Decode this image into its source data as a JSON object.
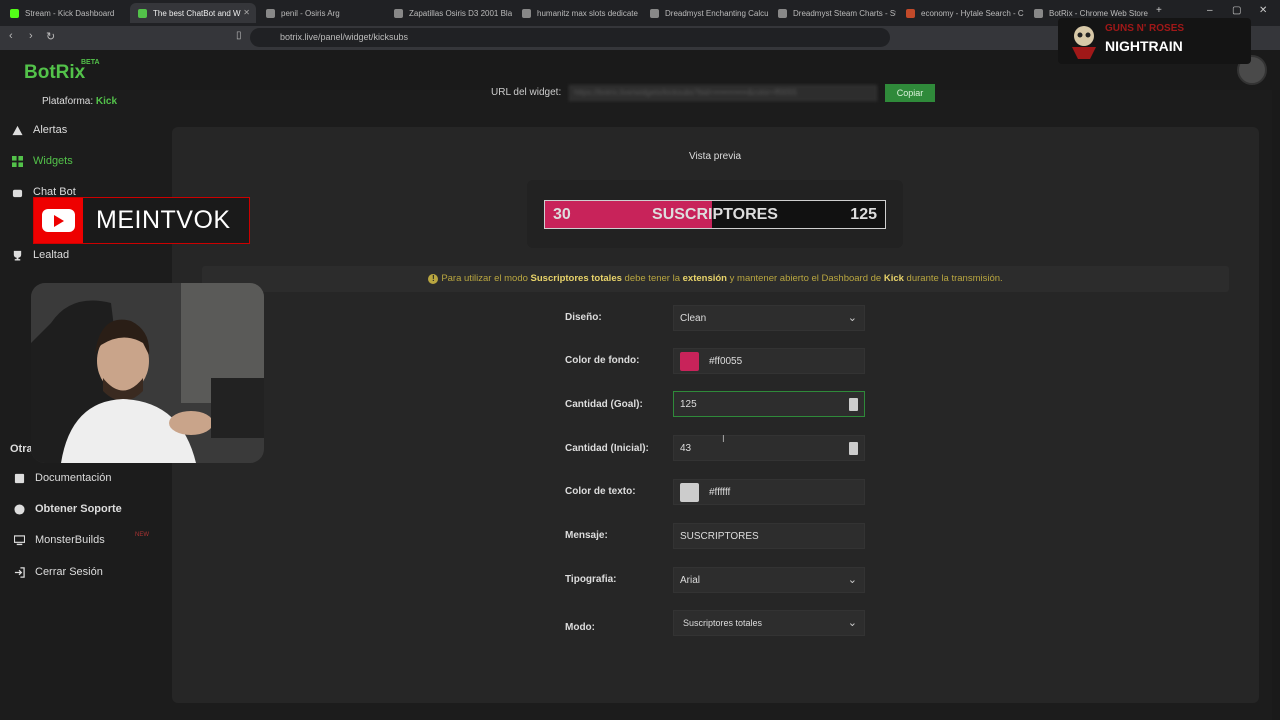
{
  "browser": {
    "tabs": [
      {
        "title": "Stream - Kick Dashboard",
        "color": "#53fc18"
      },
      {
        "title": "The best ChatBot and W",
        "color": "#53c24a",
        "active": true
      },
      {
        "title": "penil - Osiris Arg",
        "color": "#888888"
      },
      {
        "title": "Zapatillas Osiris D3 2001 Bla",
        "color": "#888888"
      },
      {
        "title": "humanitz max slots dedicate",
        "color": "#888888"
      },
      {
        "title": "Dreadmyst Enchanting Calcu",
        "color": "#888888"
      },
      {
        "title": "Dreadmyst Steam Charts - St",
        "color": "#888888"
      },
      {
        "title": "economy - Hytale Search - C",
        "color": "#c24a2a"
      },
      {
        "title": "BotRix - Chrome Web Store",
        "color": "#888888"
      }
    ],
    "url": "botrix.live/panel/widget/kicksubs"
  },
  "app": {
    "logo": "BotRix",
    "beta": "BETA",
    "platform_label": "Plataforma:",
    "platform_value": "Kick"
  },
  "sidebar": {
    "items": [
      {
        "label": "Alertas",
        "icon": "warning-icon"
      },
      {
        "label": "Widgets",
        "icon": "grid-icon",
        "active": true
      },
      {
        "label": "Chat Bot",
        "icon": "bot-icon"
      },
      {
        "label": "Lealtad",
        "icon": "trophy-icon"
      }
    ],
    "other_heading": "Otra",
    "other_items": [
      {
        "label": "Documentación",
        "icon": "doc-icon"
      },
      {
        "label": "Obtener Soporte",
        "icon": "help-icon"
      },
      {
        "label": "MonsterBuilds",
        "icon": "monitor-icon"
      },
      {
        "label": "Cerrar Sesión",
        "icon": "logout-icon"
      }
    ],
    "new_badge": "NEW"
  },
  "widget_url": {
    "label": "URL del widget:",
    "value": "https://botrix.live/widgets/kicksubs?bid=••••••••••••&color=ff0055",
    "copy_label": "Copiar"
  },
  "preview": {
    "label": "Vista previa",
    "current": "30",
    "message": "SUSCRIPTORES",
    "goal": "125",
    "fill_fraction": 0.49,
    "fill_color": "#c8235a"
  },
  "notice": {
    "p1": "Para utilizar el modo ",
    "b1": "Suscriptores totales",
    "p2": " debe tener la ",
    "b2": "extensión",
    "p3": " y mantener abierto el Dashboard de ",
    "b3": "Kick",
    "p4": " durante la transmisión."
  },
  "form": {
    "design_label": "Diseño:",
    "design_value": "Clean",
    "bg_label": "Color de fondo:",
    "bg_value": "#ff0055",
    "bg_swatch": "#c8235a",
    "goal_label": "Cantidad (Goal):",
    "goal_value": "125",
    "initial_label": "Cantidad (Inicial):",
    "initial_value": "43",
    "text_color_label": "Color de texto:",
    "text_color_value": "#ffffff",
    "text_swatch": "#cccccc",
    "message_label": "Mensaje:",
    "message_value": "SUSCRIPTORES",
    "font_label": "Tipografia:",
    "font_value": "Arial",
    "mode_label": "Modo:",
    "mode_value": "Suscriptores totales"
  },
  "overlay": {
    "yt_channel": "MEINTVOK",
    "music_band": "GUNS N' ROSES",
    "music_song": "NIGHTRAIN"
  }
}
